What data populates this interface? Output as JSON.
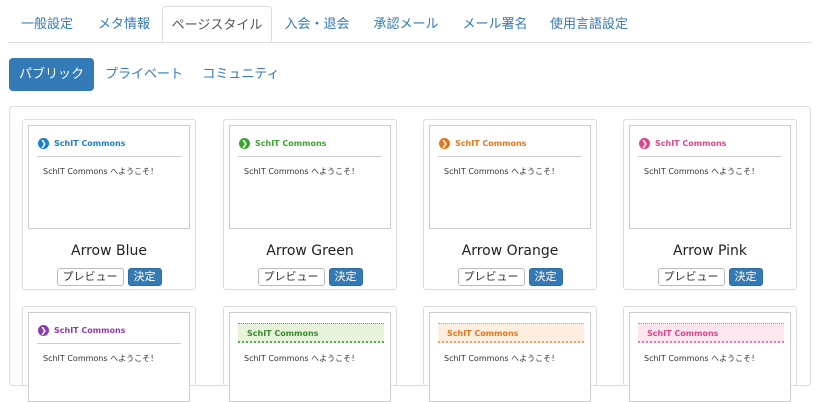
{
  "tabs": [
    "一般設定",
    "メタ情報",
    "ページスタイル",
    "入会・退会",
    "承認メール",
    "メール署名",
    "使用言語設定"
  ],
  "active_tab": "ページスタイル",
  "pills": [
    "パブリック",
    "プライベート",
    "コミュニティ"
  ],
  "active_pill": "パブリック",
  "preview": {
    "site_name": "SchIT Commons",
    "welcome": "SchIT Commons へようこそ！"
  },
  "buttons": {
    "preview": "プレビュー",
    "decide": "決定"
  },
  "styles": [
    {
      "name": "Arrow Blue",
      "color": "#1a7fd0",
      "icon": "arrow-circle-icon"
    },
    {
      "name": "Arrow Green",
      "color": "#3aa52e",
      "icon": "arrow-circle-icon"
    },
    {
      "name": "Arrow Orange",
      "color": "#e8751a",
      "icon": "arrow-circle-icon"
    },
    {
      "name": "Arrow Pink",
      "color": "#e0448a",
      "icon": "arrow-circle-icon"
    },
    {
      "color": "#8e3bb0",
      "icon": "arrow-circle-icon"
    },
    {
      "color": "#3a8a2a",
      "bg": "#e8f3dc",
      "border": "#4caf50"
    },
    {
      "color": "#e8751a",
      "bg": "#fdeee0",
      "border": "#f0a060"
    },
    {
      "color": "#e0448a",
      "bg": "#fde6ef",
      "border": "#e87aa8"
    }
  ]
}
